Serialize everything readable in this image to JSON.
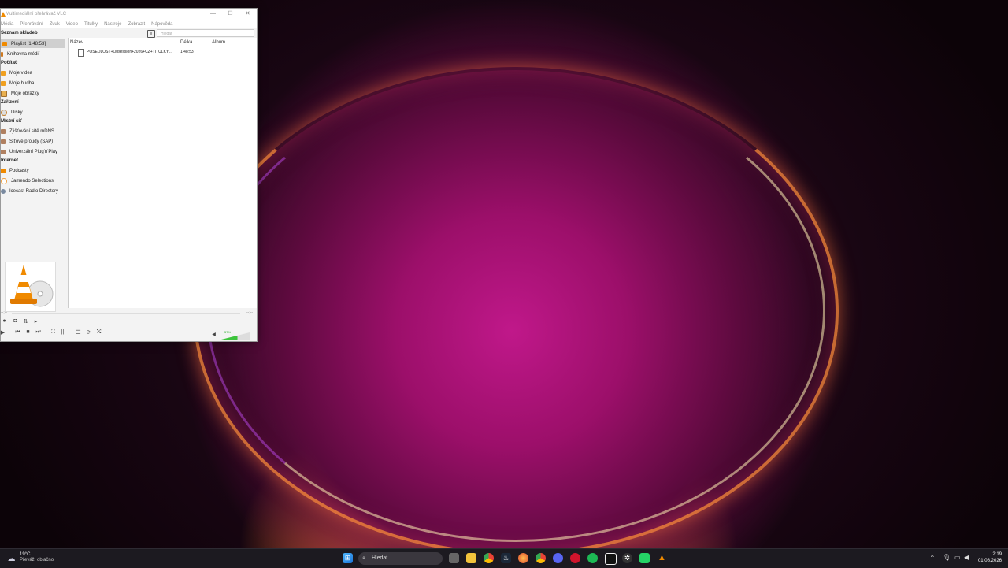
{
  "window": {
    "title": "Multimediální přehrávač VLC",
    "menu": [
      "Média",
      "Přehrávání",
      "Zvuk",
      "Video",
      "Titulky",
      "Nástroje",
      "Zobrazit",
      "Nápověda"
    ],
    "sidebar_header": "Seznam skladeb",
    "search_placeholder": "Hledat"
  },
  "sidebar": {
    "playlist": "Playlist [1:48:53]",
    "library": "Knihovna médií",
    "cat_computer": "Počítač",
    "my_videos": "Moje videa",
    "my_music": "Moje hudba",
    "my_pictures": "Moje obrázky",
    "cat_devices": "Zařízení",
    "discs": "Disky",
    "cat_network": "Místní síť",
    "mdns": "Zjišťování sítě mDNS",
    "sap": "Síťové proudy (SAP)",
    "upnp": "Univerzální Plug'n'Play",
    "cat_internet": "Internet",
    "podcasts": "Podcasty",
    "jamendo": "Jamendo Selections",
    "icecast": "Icecast Radio Directory"
  },
  "playlist": {
    "col_name": "Název",
    "col_length": "Délka",
    "col_album": "Album",
    "rows": [
      {
        "name": "POSEDLOST+Obsession+2026+CZ+TITULKY...",
        "length": "1:48:53",
        "album": ""
      }
    ]
  },
  "controls": {
    "time_left": "--:--",
    "time_right": "--:--",
    "volume": "57%"
  },
  "taskbar": {
    "temperature": "19°C",
    "weather": "Převáž. oblačno",
    "search": "Hledat",
    "time": "2:19",
    "date": "01.08.2026"
  },
  "colors": {
    "accent": "#ff8800",
    "volume_fill": "#3cc43c"
  }
}
